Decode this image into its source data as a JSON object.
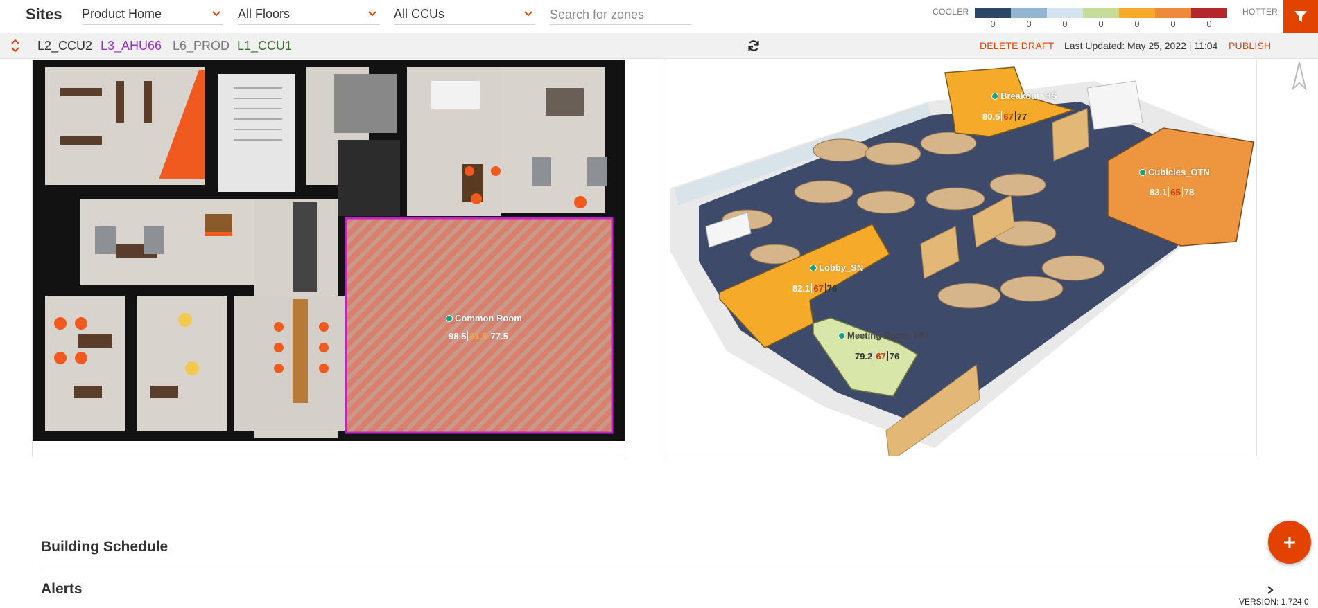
{
  "header": {
    "title": "Sites",
    "site_select": {
      "value": "Product Home"
    },
    "floor_select": {
      "value": "All Floors"
    },
    "ccu_select": {
      "value": "All CCUs"
    },
    "search": {
      "placeholder": "Search for zones",
      "value": ""
    }
  },
  "temp_scale": {
    "cooler_label": "COOLER",
    "hotter_label": "HOTTER",
    "segments": [
      {
        "color": "#2d4668",
        "count": "0"
      },
      {
        "color": "#92b5d0",
        "count": "0"
      },
      {
        "color": "#d3e3f0",
        "count": "0"
      },
      {
        "color": "#c6dc9a",
        "count": "0"
      },
      {
        "color": "#f6aa2a",
        "count": "0"
      },
      {
        "color": "#ee8a3b",
        "count": "0"
      },
      {
        "color": "#b3282d",
        "count": "0"
      }
    ]
  },
  "toolbar": {
    "floor_tabs": [
      {
        "label": "L2_CCU2",
        "color": "#333333"
      },
      {
        "label": "L3_AHU66",
        "color": "#9b30c8"
      },
      {
        "label": "L6_PROD",
        "color": "#777777"
      },
      {
        "label": "L1_CCU1",
        "color": "#3b6f2f"
      }
    ],
    "delete_draft": "DELETE DRAFT",
    "last_updated": "Last Updated: May 25, 2022 | 11:04",
    "publish": "PUBLISH"
  },
  "floor_plan_left": {
    "zones": [
      {
        "name": "Common Room",
        "current": "98.5",
        "cooling": "61.5",
        "heating": "77.5"
      }
    ]
  },
  "floor_plan_right": {
    "zones": [
      {
        "name": "Breakout_HS",
        "current": "80.5",
        "cooling": "67",
        "heating": "77"
      },
      {
        "name": "Cubicles_OTN",
        "current": "83.1",
        "cooling": "65",
        "heating": "78"
      },
      {
        "name": "Lobby_SN",
        "current": "82.1",
        "cooling": "67",
        "heating": "76"
      },
      {
        "name": "Meeting Room_HN",
        "current": "79.2",
        "cooling": "67",
        "heating": "76"
      }
    ]
  },
  "sections": {
    "building_schedule": "Building Schedule",
    "alerts": "Alerts"
  },
  "footer": {
    "version": "VERSION: 1.724.0"
  },
  "colors": {
    "accent": "#e24301",
    "zone_dot": "#14a37f"
  }
}
